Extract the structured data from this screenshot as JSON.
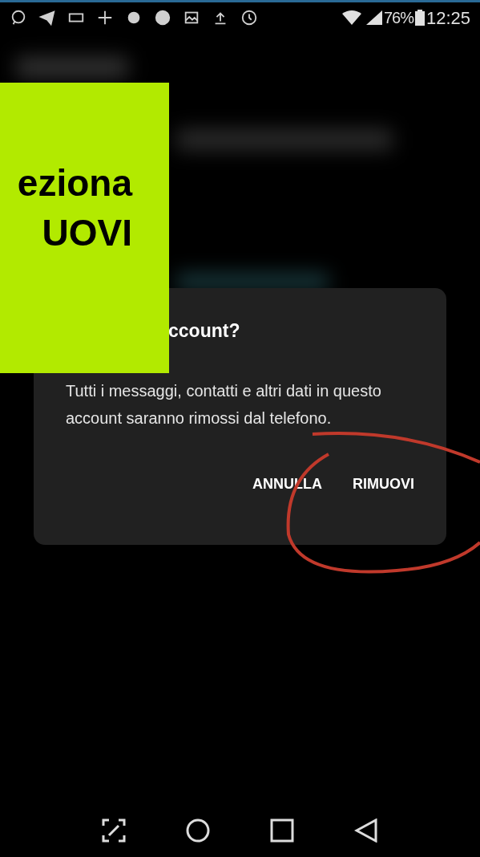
{
  "status_bar": {
    "battery": "76%",
    "time": "12:25"
  },
  "overlay_banner": {
    "lines": [
      "eziona",
      "UOVI"
    ]
  },
  "dialog": {
    "title": "ccount?",
    "message": "Tutti i messaggi, contatti e altri dati in questo account saranno rimossi dal telefono.",
    "buttons": [
      "ANNULLA",
      "RIMUOVI"
    ]
  }
}
